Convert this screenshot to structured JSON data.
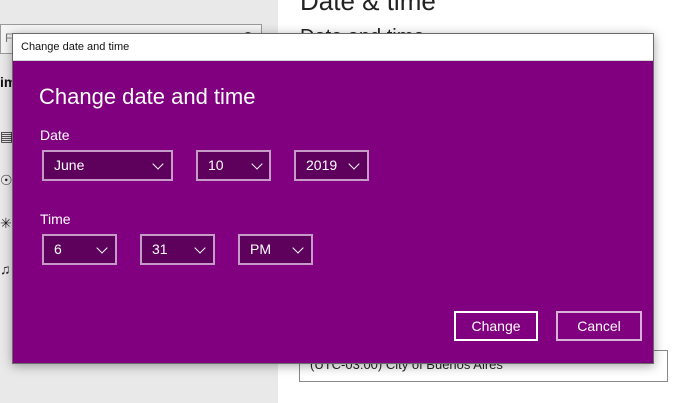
{
  "background": {
    "search_placeholder": "Fi",
    "nav_label": "im",
    "heading_top": "Date & time",
    "heading_sub": "Date and time",
    "timezone_value": "(UTC-03:00) City of Buenos Aires"
  },
  "dialog": {
    "window_title": "Change date and time",
    "heading": "Change date and time",
    "date_label": "Date",
    "time_label": "Time",
    "date": {
      "month": "June",
      "day": "10",
      "year": "2019"
    },
    "time": {
      "hour": "6",
      "minute": "31",
      "ampm": "PM"
    },
    "change_label": "Change",
    "cancel_label": "Cancel"
  },
  "colors": {
    "dialog_bg": "#800080",
    "dropdown_bg": "#5d015d",
    "dropdown_border": "#c79bc7"
  }
}
